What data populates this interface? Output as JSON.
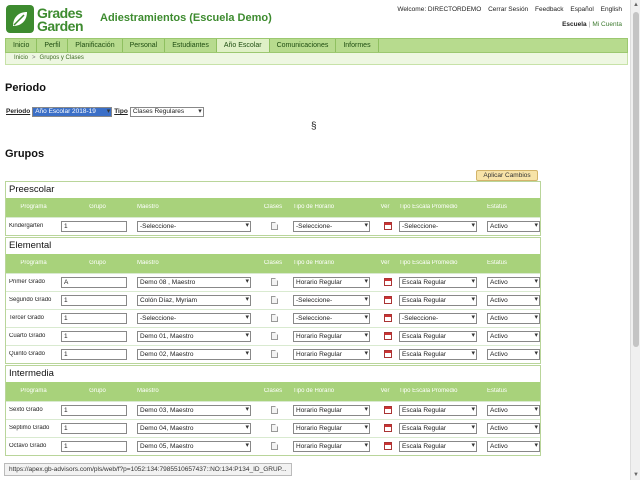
{
  "logo": {
    "line1": "Grades",
    "line2": "Garden"
  },
  "app_title": "Adiestramientos (Escuela Demo)",
  "top_links": {
    "welcome": "Welcome: DIRECTORDEMO",
    "logout": "Cerrar Sesión",
    "feedback": "Feedback",
    "lang_es": "Español",
    "lang_en": "English"
  },
  "school_links": {
    "school": "Escuela",
    "separator": "|",
    "account": "Mi Cuenta"
  },
  "nav": [
    "Inicio",
    "Perfil",
    "Planificación",
    "Personal",
    "Estudiantes",
    "Año Escolar",
    "Comunicaciones",
    "Informes"
  ],
  "nav_active": "Año Escolar",
  "breadcrumb": {
    "home": "Inicio",
    "sep": ">",
    "current": "Grupos y Clases"
  },
  "periodo": {
    "heading": "Periodo",
    "periodo_label": "Periodo",
    "periodo_value": "Año Escolar 2018-19",
    "tipo_label": "Tipo",
    "tipo_value": "Clases Regulares",
    "section_mark": "§"
  },
  "grupos": {
    "heading": "Grupos",
    "apply_button": "Aplicar Cambios"
  },
  "columns": {
    "programa": "Programa",
    "grupo": "Grupo",
    "maestro": "Maestro",
    "clases": "Clases",
    "tipo_horario": "Tipo de Horario",
    "ver": "Ver",
    "tipo_escala": "Tipo Escala Promedio",
    "estatus": "Estatus"
  },
  "sections": [
    {
      "title": "Preescolar",
      "rows": [
        {
          "programa": "Kindergarten",
          "grupo": "1",
          "maestro": "-Seleccione-",
          "horario": "-Seleccione-",
          "escala": "-Seleccione-",
          "estatus": "Activo"
        }
      ]
    },
    {
      "title": "Elemental",
      "rows": [
        {
          "programa": "Primer Grado",
          "grupo": "A",
          "maestro": "Demo 08 , Maestro",
          "horario": "Horario Regular",
          "escala": "Escala Regular",
          "estatus": "Activo"
        },
        {
          "programa": "Segundo Grado",
          "grupo": "1",
          "maestro": "Colón Díaz, Myriam",
          "horario": "-Seleccione-",
          "escala": "Escala Regular",
          "estatus": "Activo"
        },
        {
          "programa": "Tercer Grado",
          "grupo": "1",
          "maestro": "-Seleccione-",
          "horario": "-Seleccione-",
          "escala": "-Seleccione-",
          "estatus": "Activo"
        },
        {
          "programa": "Cuarto Grado",
          "grupo": "1",
          "maestro": "Demo 01, Maestro",
          "horario": "Horario Regular",
          "escala": "Escala Regular",
          "estatus": "Activo"
        },
        {
          "programa": "Quinto Grado",
          "grupo": "1",
          "maestro": "Demo 02, Maestro",
          "horario": "Horario Regular",
          "escala": "Escala Regular",
          "estatus": "Activo"
        }
      ]
    },
    {
      "title": "Intermedia",
      "rows": [
        {
          "programa": "Sexto Grado",
          "grupo": "1",
          "maestro": "Demo 03, Maestro",
          "horario": "Horario Regular",
          "escala": "Escala Regular",
          "estatus": "Activo"
        },
        {
          "programa": "Séptimo Grado",
          "grupo": "1",
          "maestro": "Demo 04, Maestro",
          "horario": "Horario Regular",
          "escala": "Escala Regular",
          "estatus": "Activo"
        },
        {
          "programa": "Octavo Grado",
          "grupo": "1",
          "maestro": "Demo 05, Maestro",
          "horario": "Horario Regular",
          "escala": "Escala Regular",
          "estatus": "Activo"
        }
      ]
    }
  ],
  "status_url": "https://apex.gb-advisors.com/pls/web/f?p=1052:134:7985510657437::NO:134:P134_ID_GRUP...",
  "colors": {
    "brand_green": "#3d8b2f",
    "nav_bg": "#b7db8e",
    "header_row_bg": "#a8d27b",
    "apply_button_bg": "#f7e3a8"
  }
}
